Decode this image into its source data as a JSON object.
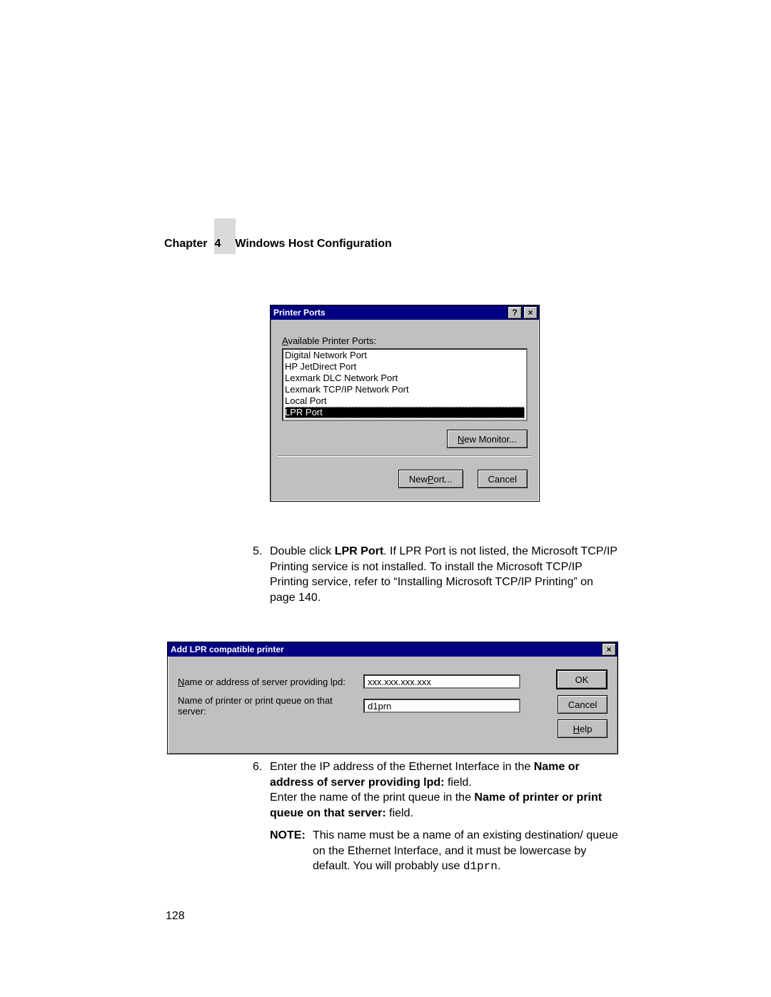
{
  "header": {
    "chapter_word": "Chapter",
    "chapter_num": "4",
    "title": "Windows Host Configuration"
  },
  "dlg1": {
    "title": "Printer Ports",
    "help_btn": "?",
    "close_btn": "×",
    "label": "Available Printer Ports:",
    "items": [
      "Digital Network Port",
      "HP JetDirect Port",
      "Lexmark DLC Network Port",
      "Lexmark TCP/IP Network Port",
      "Local Port",
      "LPR Port"
    ],
    "new_monitor": "New Monitor...",
    "new_port": "New Port...",
    "cancel": "Cancel"
  },
  "step5": {
    "num": "5.",
    "pre": "Double click ",
    "bold1": "LPR Port",
    "rest": ". If LPR Port is not listed, the Microsoft TCP/IP Printing service is not installed. To install the Microsoft TCP/IP Printing service, refer to “Installing Microsoft TCP/IP Printing” on page 140."
  },
  "dlg2": {
    "title": "Add LPR compatible printer",
    "close_btn": "×",
    "label1": "Name or address of server providing lpd:",
    "label2": "Name of printer or print queue on that server:",
    "val1": "xxx.xxx.xxx.xxx",
    "val2": "d1prn",
    "ok": "OK",
    "cancel": "Cancel",
    "help": "Help"
  },
  "step6": {
    "num": "6.",
    "t1": "Enter the IP address of the Ethernet Interface in the ",
    "b1": "Name or address of server providing lpd:",
    "t2": " field.",
    "t3": "Enter the name of the print queue in the ",
    "b2": "Name of printer or print queue on that server:",
    "t4": " field."
  },
  "note": {
    "label": "NOTE:",
    "t1": "This name must be a name of an existing destination/ queue on the Ethernet Interface, and it must be lowercase by default. You will probably use ",
    "code": "d1prn",
    "t2": "."
  },
  "page_number": "128"
}
